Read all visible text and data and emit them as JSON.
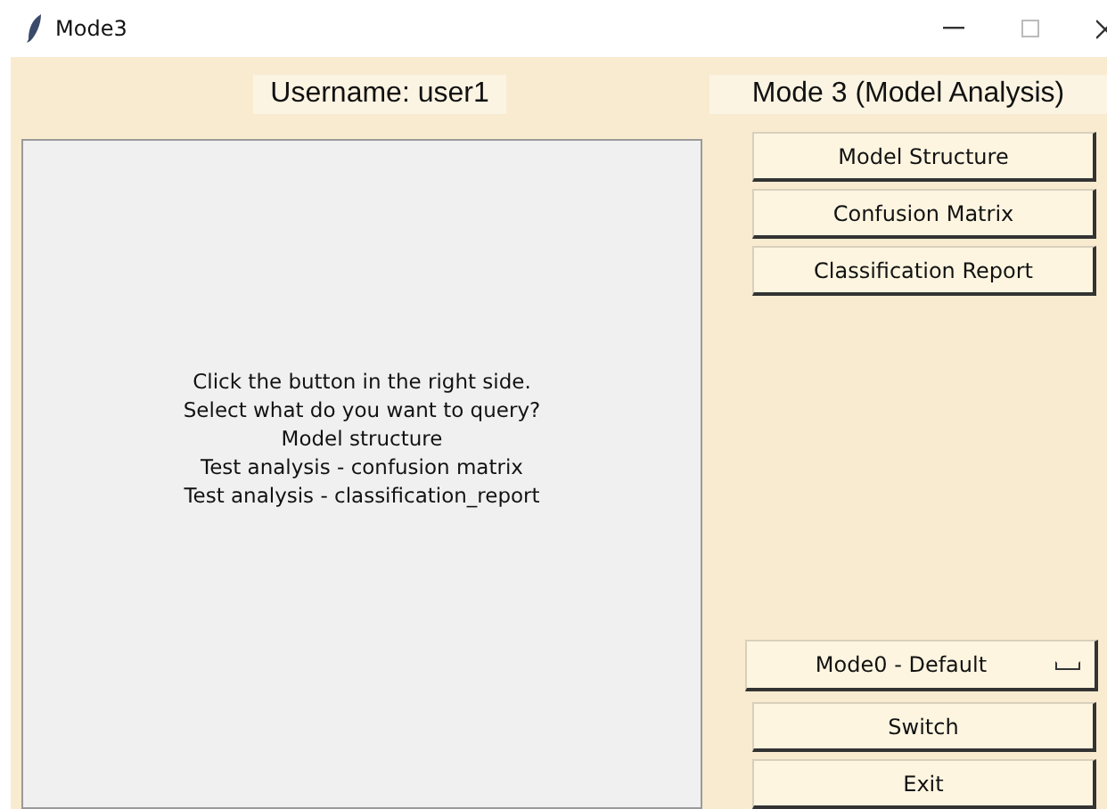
{
  "window": {
    "title": "Mode3"
  },
  "username_label": "Username: user1",
  "mode_label": "Mode 3 (Model Analysis)",
  "output_panel": {
    "lines": [
      "Click the button in the right side.",
      "Select what do you want to query?",
      "Model structure",
      "Test analysis - confusion matrix",
      "Test analysis - classification_report"
    ]
  },
  "query_buttons": [
    "Model Structure",
    "Confusion Matrix",
    "Classification Report"
  ],
  "mode_dropdown": {
    "value": "Mode0 - Default"
  },
  "action_buttons": [
    "Switch",
    "Exit"
  ]
}
